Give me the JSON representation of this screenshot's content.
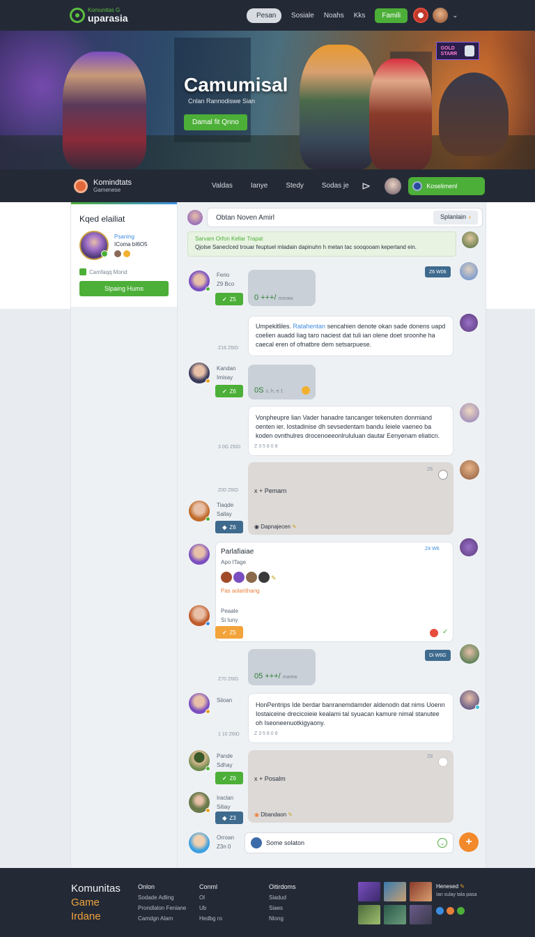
{
  "topnav": {
    "logo_small": "Komunitas G",
    "logo_big": "uparasia",
    "links": [
      "Pesan",
      "Sosiale",
      "Noahs",
      "Kks"
    ],
    "cta": "Famili"
  },
  "hero": {
    "title": "Camumisal",
    "subtitle": "Cnlan Rannodiswe Sian",
    "button": "Damal fit Qnno",
    "badge_line1": "GOLD",
    "badge_line2": "STARR"
  },
  "subnav": {
    "brand_name": "Komindtats",
    "brand_sub": "Gamenese",
    "links": [
      "Valdas",
      "Ianye",
      "Stedy",
      "Sodas je"
    ],
    "cta": "Koselimenl"
  },
  "sidebar": {
    "title": "Kqed elailiat",
    "profile_role": "Psaning",
    "profile_name": "IComa bI6O5",
    "mode_label": "Camfaqq Mond",
    "button": "Slpaing Hums"
  },
  "chat": {
    "search_value": "Obtan Noven Amirl",
    "sort_label": "Splanlain",
    "notice_title": "Sarvam Orfon Kellar Trapat",
    "notice_body": "Qjolse Saneclced trouar feuptuel mladain dapinuhn h metan tac sooqooam kepertand ein.",
    "messages": [
      {
        "name": "Ferio",
        "meta": "Z9 Bco",
        "chip": "Z5",
        "score": "0 +++/",
        "score_small": "moraw"
      },
      {
        "tag": "Z6 W06"
      },
      {
        "text_pre": "Umpekitliles. ",
        "highlight": "Ratahentan",
        "text_post": " sencahien denote okan sade donens uapd coelien auadd Iiag taro naciest dat tuli ian olene doet sroonhe ha caecal eren of ofnatbre dem setsarpuese.",
        "stamp": "Z16 Z6ID"
      },
      {
        "name": "Kandan",
        "meta": "Imisay",
        "chip": "Z6",
        "score": "0S",
        "score_mid": "s, h, e 1"
      },
      {
        "text": "Vonpheupre lian Vader hanadre tancanger tekenuten donmiand oenten ier. Iostadinise dh sevsedentam bandu Ieiele vaeneo ba koden ovnthulres drocenoeeonlrululuan dautar Eenyenam eliaticn.",
        "stamp": "3 0G Z6ID",
        "stamp2": "Z 3 5 8 0 8"
      },
      {
        "name": "Tiaqde",
        "meta": "Sallay",
        "chip": "Z6",
        "body": "x + Pemarn",
        "stamp": "Z00 Z6ID",
        "stamp_small": "Z6",
        "foot": "Dapnajecen"
      },
      {
        "name": "Parlafiaiae",
        "meta": "Apo ITage",
        "stamp": "Z4 W6",
        "orange": "Pas aolarithang",
        "name2": "Peaale",
        "meta2": "Si Iuny",
        "chip": "Z5"
      },
      {
        "tag": "Di W6G"
      },
      {
        "score": "05 +++/",
        "score_small": "marew",
        "stamp": "Z70 Z6ID"
      },
      {
        "name": "Siioan",
        "text": "HonPentrips Ide berdar banranemdamder aldenodn dat nims Uoenn Iostaiceine drecicoieie kealami tal syuacan kamure nimal stanutee oh Iseoneenuotkigyaony.",
        "stamp": "1 10 Z6ID",
        "stamp2": "Z 3 5 8 0 8"
      },
      {
        "name": "Pande",
        "meta": "Sdhay",
        "chip": "Z6",
        "body": "x + Posalm",
        "stamp_small": "Z8",
        "foot": "Dbandaon"
      },
      {
        "name": "Iraclan",
        "meta": "Sitiay",
        "chip": "Z3"
      },
      {
        "name": "Orroan",
        "meta": "Z3n 0"
      }
    ],
    "composer_value": "Some solaton"
  },
  "footer": {
    "brand": [
      "Komunitas",
      "Game",
      "Irdane"
    ],
    "col1": {
      "heading": "Onlon",
      "items": [
        "Sodade Adling",
        "Prondlalon Feniane",
        "Camdgn Alam"
      ]
    },
    "col2": {
      "heading": "Conml",
      "items": [
        "Ol",
        "Ub",
        "Hedbg ro"
      ]
    },
    "col3": {
      "heading": "Oitirdoms",
      "items": [
        "Siadud",
        "Siaes",
        "Nlong"
      ]
    },
    "right_title": "Henesed",
    "right_sub": "Ian sulay tala pasa"
  }
}
